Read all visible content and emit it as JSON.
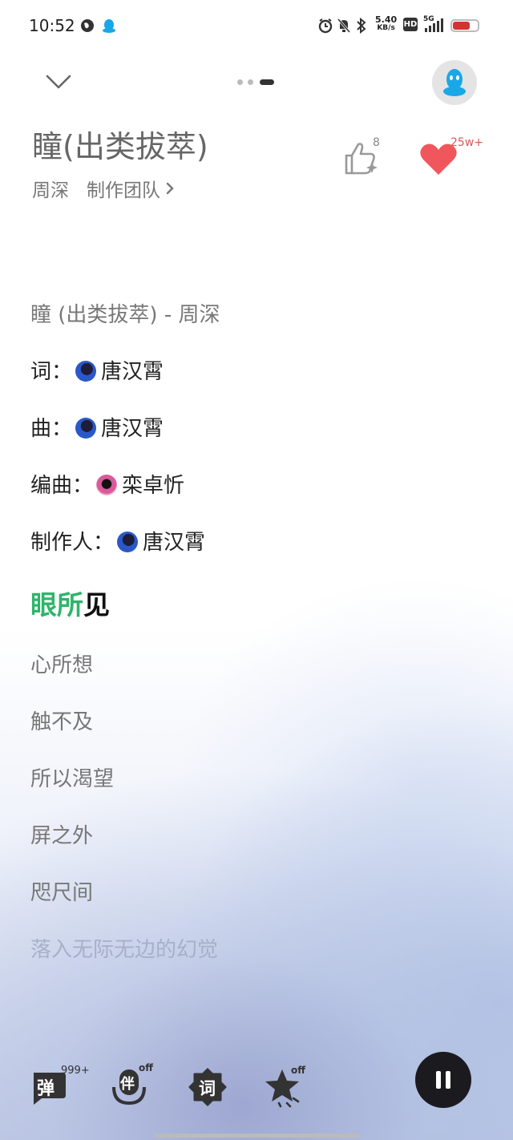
{
  "status_bar": {
    "time": "10:52",
    "net_speed_value": "5.40",
    "net_speed_unit": "KB/s",
    "hd_label": "HD",
    "signal_label": "5G",
    "battery_level": 0.7,
    "battery_color": "#d33333"
  },
  "header": {
    "song_title": "瞳(出类拔萃)",
    "artist": "周深",
    "team_label": "制作团队",
    "like_count": "8",
    "favorite_count": "25w+",
    "heart_color": "#f0575c"
  },
  "lyrics": {
    "meta": [
      {
        "text": "瞳 (出类拔萃) - 周深"
      },
      {
        "label": "词：",
        "name": "唐汉霄",
        "avatar": "blue"
      },
      {
        "label": "曲：",
        "name": "唐汉霄",
        "avatar": "blue"
      },
      {
        "label": "编曲：",
        "name": "栾卓忻",
        "avatar": "pink"
      },
      {
        "label": "制作人：",
        "name": "唐汉霄",
        "avatar": "blue"
      }
    ],
    "current_line_sung": "眼所",
    "current_line_rest": "见",
    "highlight_color": "#2db56a",
    "lines": [
      "心所想",
      "触不及",
      "所以渴望",
      "屏之外",
      "咫尺间",
      "落入无际无边的幻觉"
    ]
  },
  "toolbar": {
    "danmaku_label": "弹",
    "danmaku_count": "999+",
    "accompany_label": "伴",
    "accompany_state": "off",
    "lyrics_label": "词",
    "effect_state": "off"
  }
}
